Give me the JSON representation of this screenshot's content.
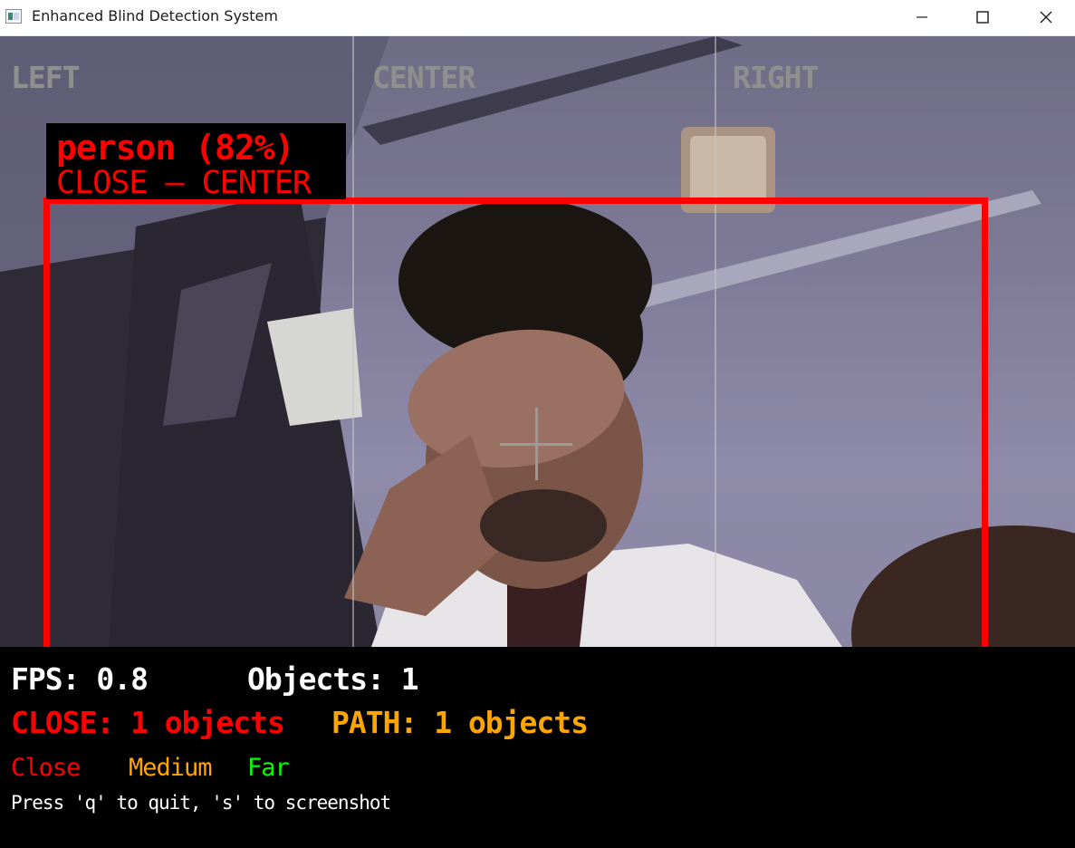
{
  "window": {
    "title": "Enhanced Blind Detection System",
    "icon": "app-window-icon",
    "controls": [
      "minimize-icon",
      "maximize-icon",
      "close-icon"
    ]
  },
  "zones": {
    "left": "LEFT",
    "center": "CENTER",
    "right": "RIGHT"
  },
  "detection": {
    "label": "person (82%)",
    "sub": "CLOSE — CENTER",
    "color": "#ff0000"
  },
  "status": {
    "fps": "FPS: 0.8",
    "objects": "Objects: 1",
    "close": "CLOSE: 1 objects",
    "path": "PATH: 1 objects"
  },
  "legend": {
    "close": "Close",
    "medium": "Medium",
    "far": "Far"
  },
  "help": "Press 'q' to quit, 's' to screenshot",
  "colors": {
    "close": "#ff0000",
    "medium": "#ffa500",
    "far": "#00ff00",
    "zone_label": "#8f8f8f"
  }
}
